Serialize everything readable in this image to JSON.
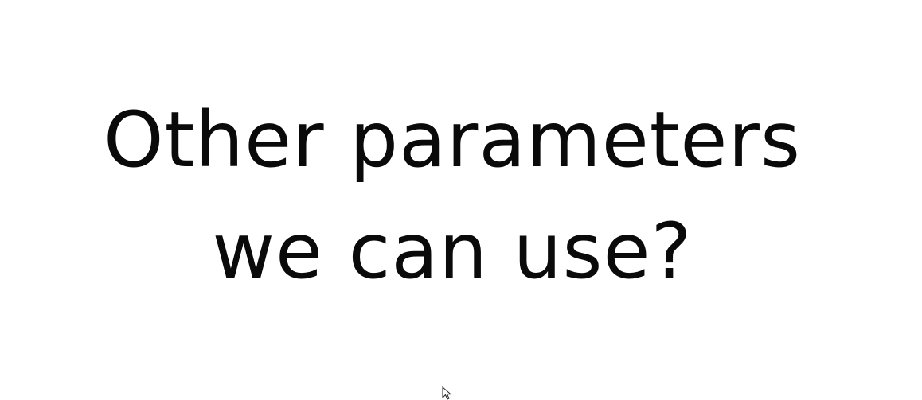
{
  "slide": {
    "title_line_1": "Other parameters",
    "title_line_2": "we can use?"
  },
  "cursor": {
    "icon": "mouse-pointer-icon"
  }
}
